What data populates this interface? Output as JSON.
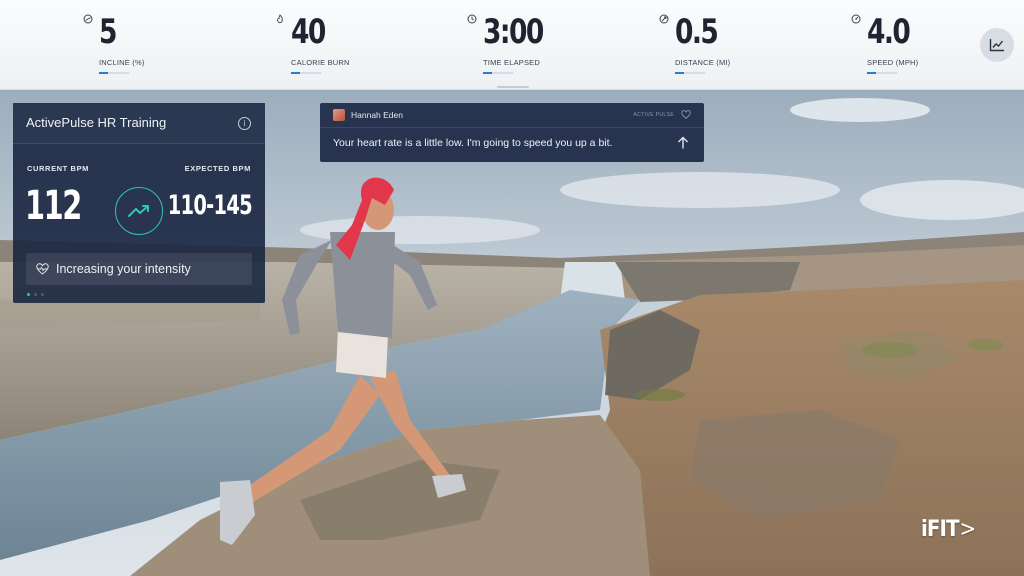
{
  "stats": [
    {
      "value": "5",
      "label": "INCLINE (%)",
      "icon": "incline-icon",
      "progress": 0.3
    },
    {
      "value": "40",
      "label": "CALORIE BURN",
      "icon": "flame-icon",
      "progress": 0.3
    },
    {
      "value": "3:00",
      "label": "TIME ELAPSED",
      "icon": "clock-icon",
      "progress": 0.3
    },
    {
      "value": "0.5",
      "label": "DISTANCE (MI)",
      "icon": "distance-icon",
      "progress": 0.3
    },
    {
      "value": "4.0",
      "label": "SPEED (MPH)",
      "icon": "speedometer-icon",
      "progress": 0.3
    }
  ],
  "chart_button_icon": "chart-icon",
  "hr_panel": {
    "title": "ActivePulse HR Training",
    "current_label": "CURRENT BPM",
    "current_value": "112",
    "expected_label": "EXPECTED BPM",
    "expected_value": "110-145",
    "trend_icon": "trend-up-icon",
    "status_icon": "heart-pulse-icon",
    "status_text": "Increasing your intensity",
    "accent_color": "#2fc6b2"
  },
  "coach": {
    "name": "Hannah Eden",
    "brand": "ACTIVE PULSE",
    "message": "Your heart rate is a little low. I'm going to speed you up a bit.",
    "arrow_icon": "arrow-up-icon"
  },
  "logo": "iFIT"
}
